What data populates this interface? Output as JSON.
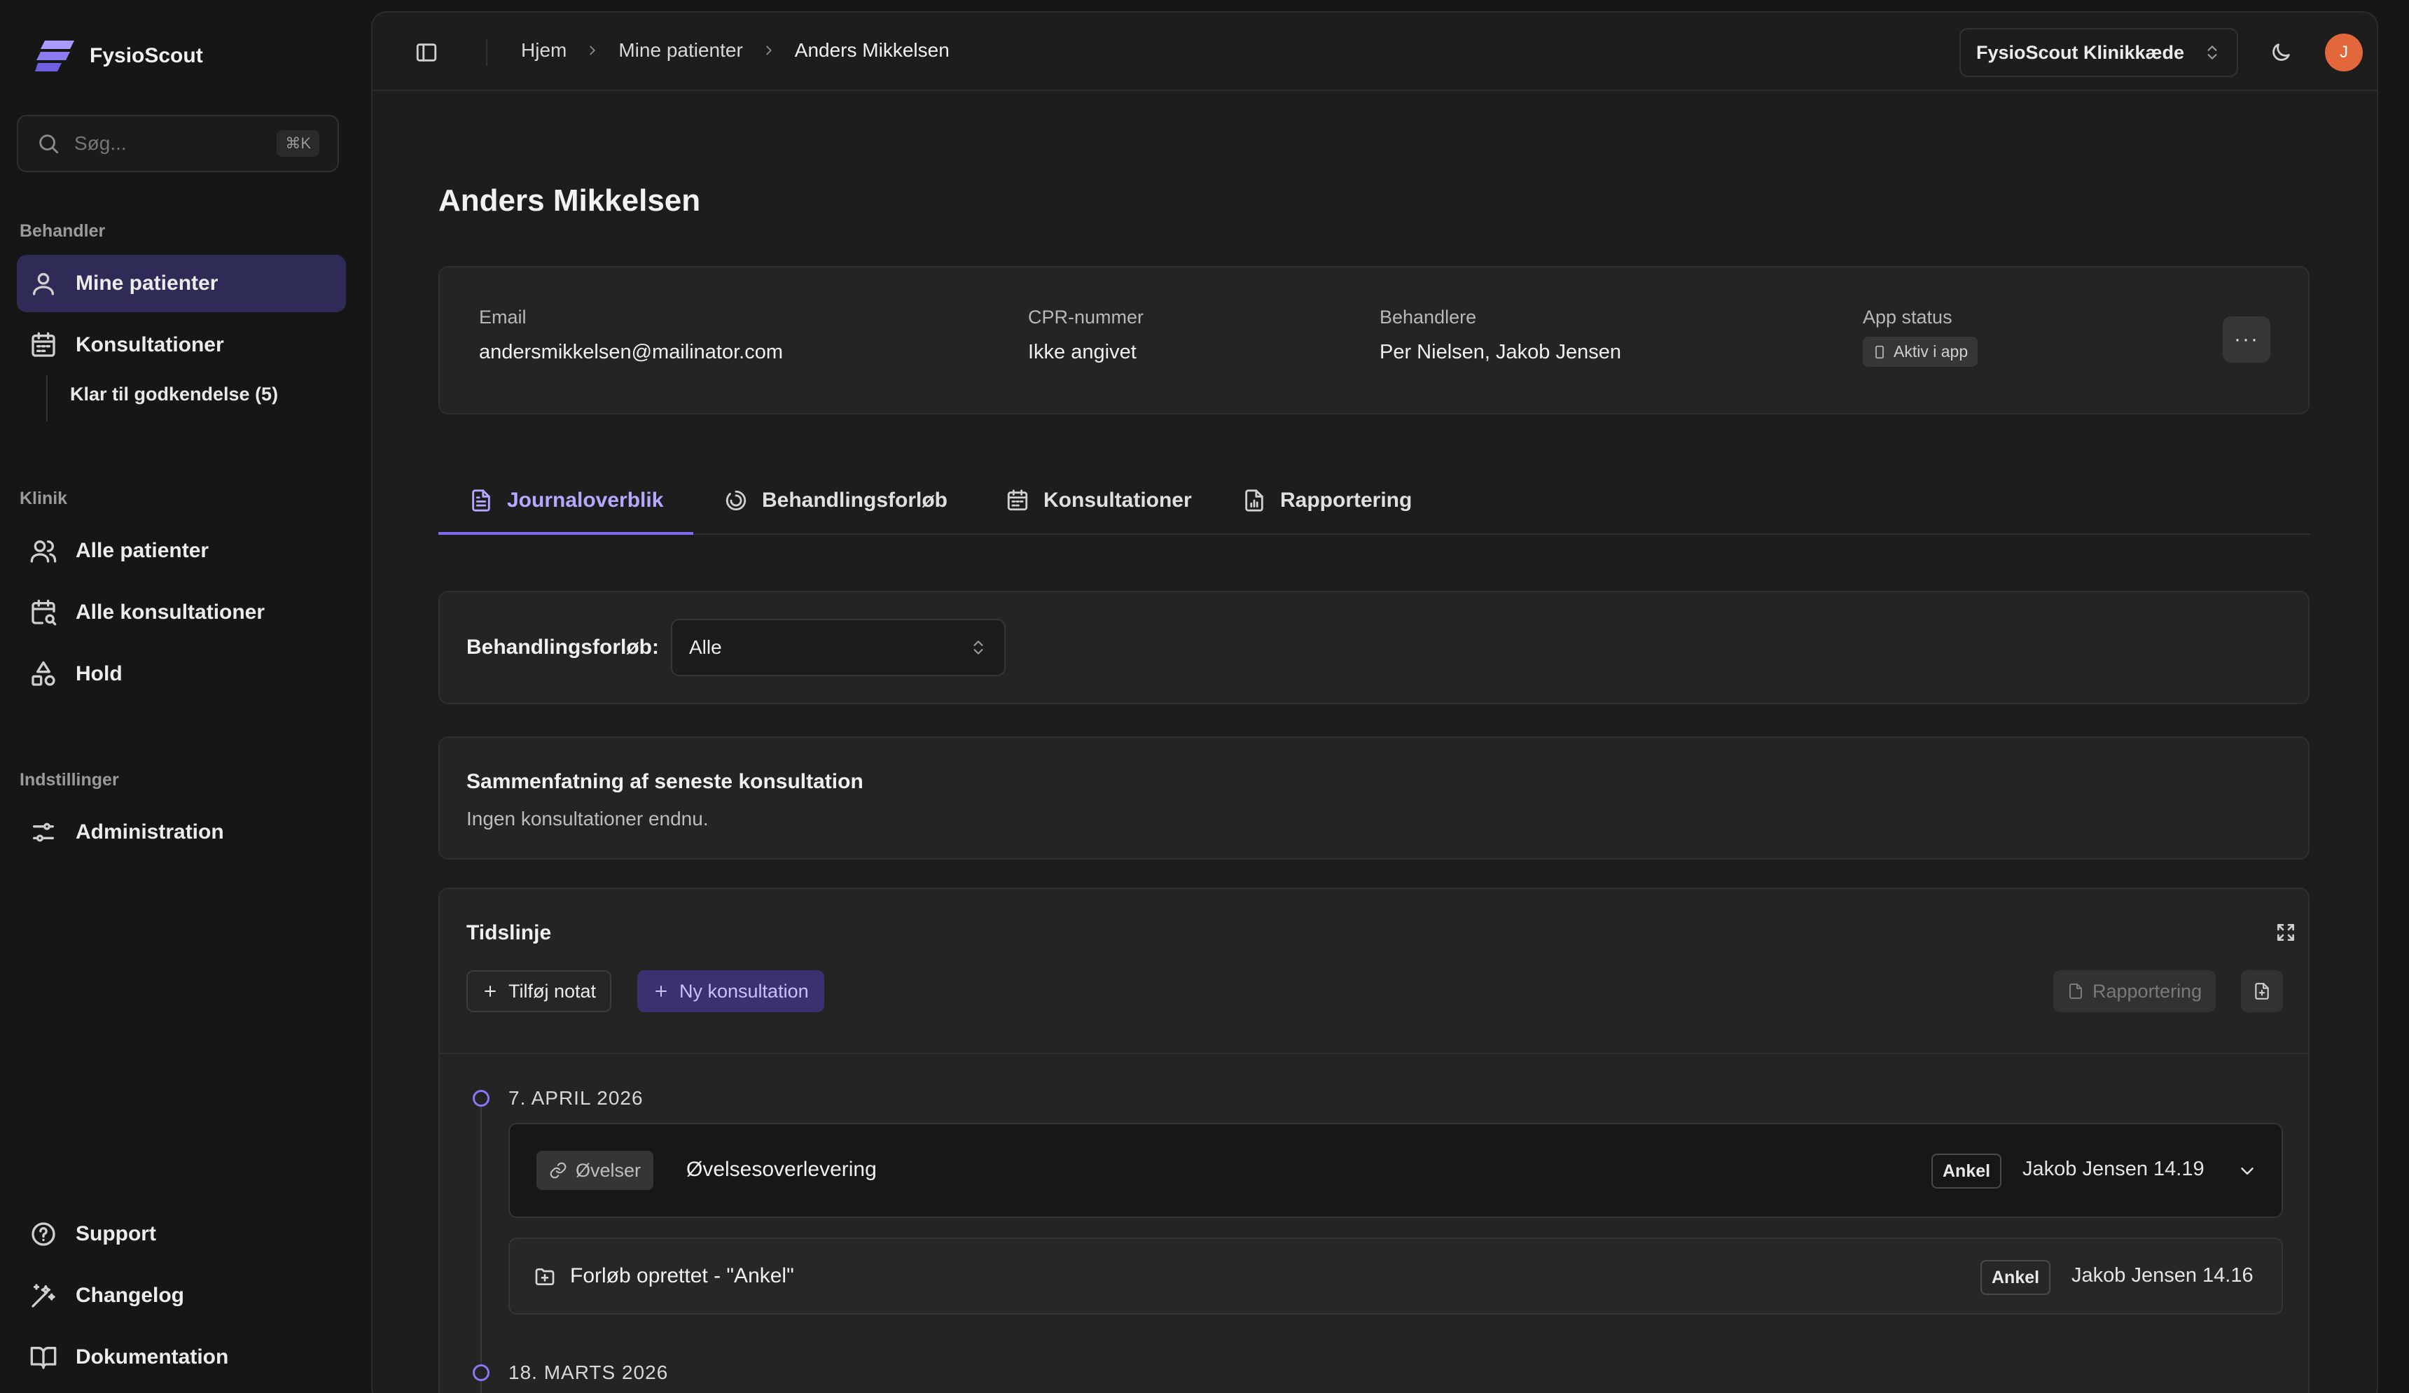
{
  "brand": {
    "name": "FysioScout"
  },
  "search": {
    "placeholder": "Søg...",
    "shortcut": "⌘K"
  },
  "sidebar": {
    "sections": [
      {
        "label": "Behandler"
      },
      {
        "label": "Klinik"
      },
      {
        "label": "Indstillinger"
      }
    ],
    "items": [
      {
        "label": "Mine patienter",
        "icon": "user-icon"
      },
      {
        "label": "Konsultationer",
        "icon": "calendar-icon"
      },
      {
        "label": "Klar til godkendelse (5)"
      },
      {
        "label": "Alle patienter",
        "icon": "users-icon"
      },
      {
        "label": "Alle konsultationer",
        "icon": "calendar-search-icon"
      },
      {
        "label": "Hold",
        "icon": "shapes-icon"
      },
      {
        "label": "Administration",
        "icon": "sliders-icon"
      }
    ],
    "footer": [
      {
        "label": "Support",
        "icon": "help-circle-icon"
      },
      {
        "label": "Changelog",
        "icon": "wand-icon"
      },
      {
        "label": "Dokumentation",
        "icon": "book-open-icon"
      }
    ]
  },
  "topbar": {
    "breadcrumb": [
      "Hjem",
      "Mine patienter",
      "Anders Mikkelsen"
    ],
    "org": "FysioScout Klinikkæde",
    "avatar_initial": "J",
    "avatar_color": "#e2683c"
  },
  "patient": {
    "name": "Anders Mikkelsen",
    "fields": {
      "email_label": "Email",
      "email": "andersmikkelsen@mailinator.com",
      "cpr_label": "CPR-nummer",
      "cpr": "Ikke angivet",
      "behandlere_label": "Behandlere",
      "behandlere": "Per Nielsen, Jakob Jensen",
      "app_label": "App status",
      "app_status": "Aktiv i app"
    },
    "more": "···"
  },
  "tabs": [
    {
      "label": "Journaloverblik",
      "icon": "file-text-icon",
      "active": true
    },
    {
      "label": "Behandlingsforløb",
      "icon": "progress-icon",
      "active": false
    },
    {
      "label": "Konsultationer",
      "icon": "calendar-icon",
      "active": false
    },
    {
      "label": "Rapportering",
      "icon": "file-chart-icon",
      "active": false
    }
  ],
  "filter": {
    "label": "Behandlingsforløb:",
    "value": "Alle"
  },
  "summary": {
    "title": "Sammenfatning af seneste konsultation",
    "text": "Ingen konsultationer endnu."
  },
  "timeline": {
    "title": "Tidslinje",
    "add_note": "Tilføj notat",
    "new_consultation": "Ny konsultation",
    "report": "Rapportering",
    "groups": [
      {
        "date": "7. APRIL 2026",
        "entries": [
          {
            "tag": "Øvelser",
            "title": "Øvelsesoverlevering",
            "chip": "Ankel",
            "meta": "Jakob Jensen 14.19"
          },
          {
            "title": "Forløb oprettet - \"Ankel\"",
            "chip": "Ankel",
            "meta": "Jakob Jensen 14.16"
          }
        ]
      },
      {
        "date": "18. MARTS 2026"
      }
    ]
  },
  "colors": {
    "accent": "#7e6cf0",
    "active_nav": "#2f2b57",
    "primary_btn": "#3a3170"
  }
}
